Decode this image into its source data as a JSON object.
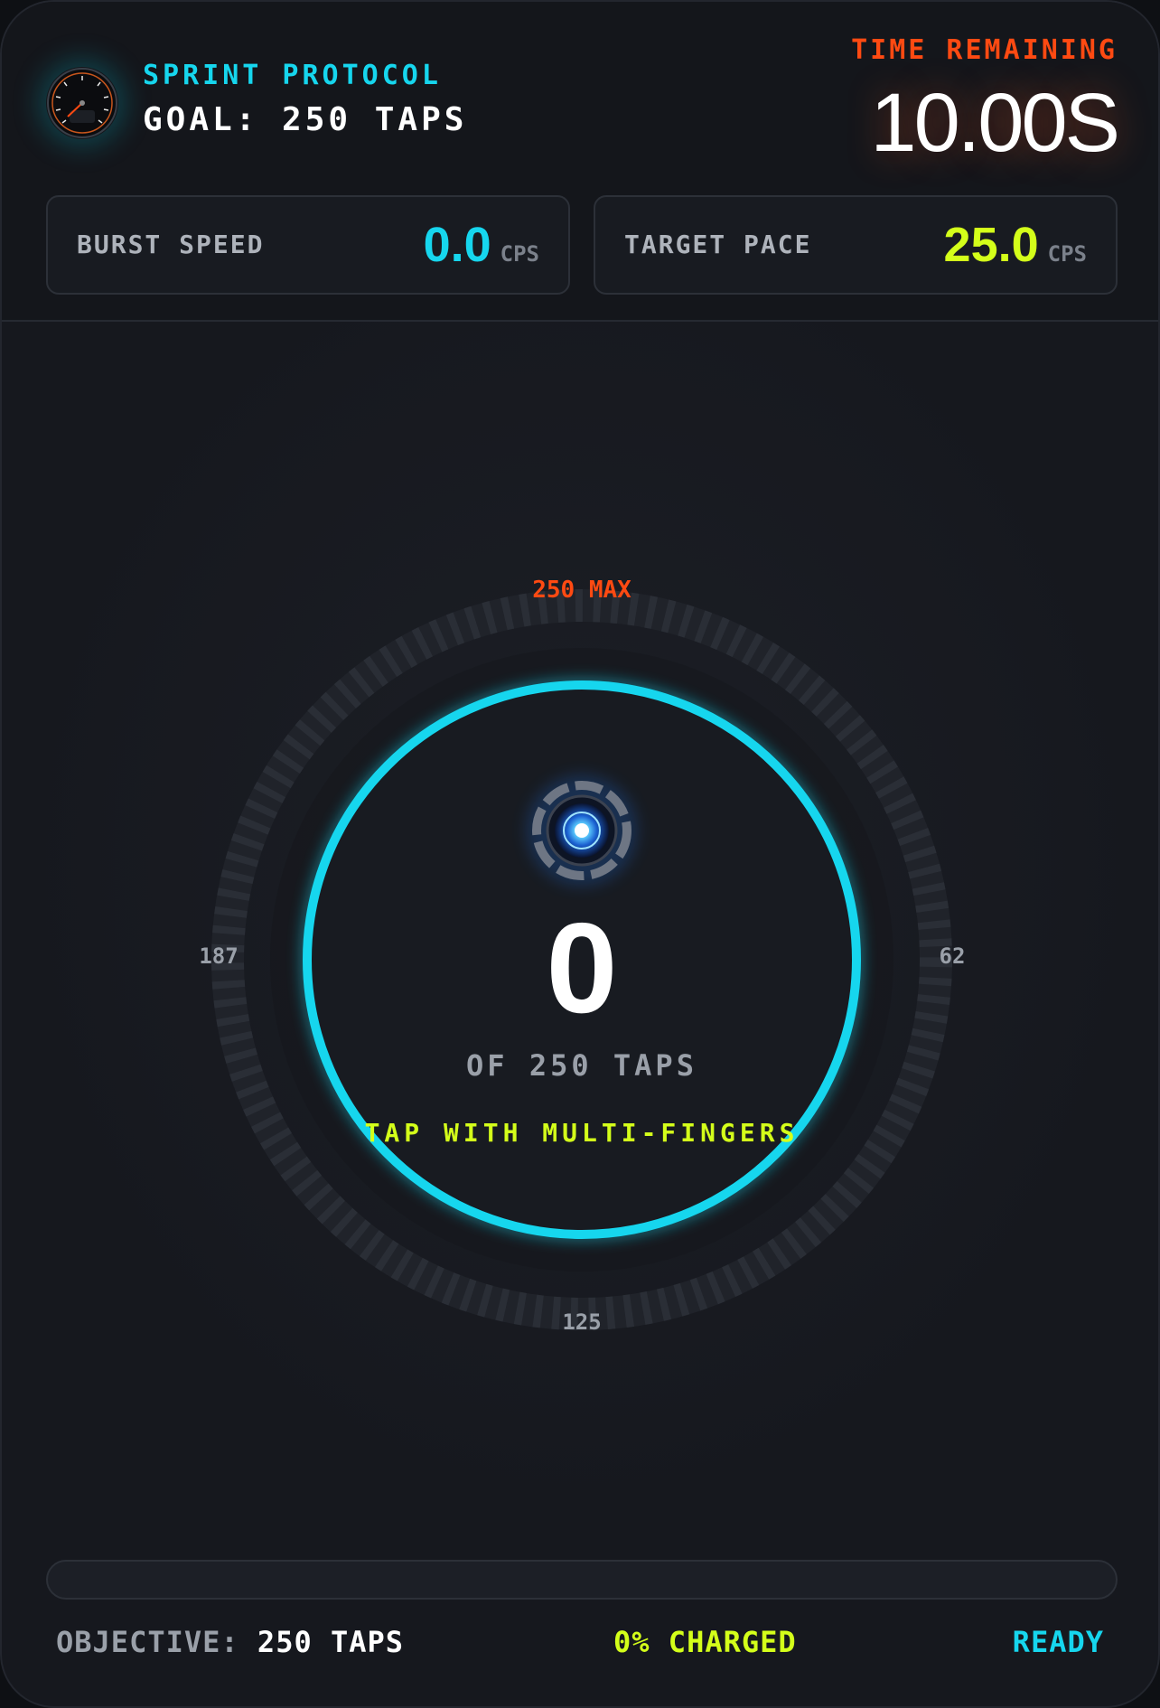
{
  "header": {
    "title": "SPRINT PROTOCOL",
    "goal": "GOAL: 250 TAPS",
    "time_label": "TIME REMAINING",
    "time_value": "10.00S"
  },
  "stats": {
    "burst": {
      "label": "BURST SPEED",
      "value": "0.0",
      "unit": "CPS"
    },
    "target": {
      "label": "TARGET PACE",
      "value": "25.0",
      "unit": "CPS"
    }
  },
  "gauge": {
    "max_label": "250 MAX",
    "tick_right": "62",
    "tick_bottom": "125",
    "tick_left": "187",
    "count": "0",
    "sub_label": "OF 250 TAPS",
    "hint": "TAP WITH MULTI-FINGERS",
    "progress_fraction": 0
  },
  "footer": {
    "objective_label": "OBJECTIVE:",
    "objective_value": "250 TAPS",
    "charged": "0% CHARGED",
    "status": "READY",
    "progress_percent": 0
  },
  "colors": {
    "cyan": "#16d6ee",
    "orange": "#ff4a12",
    "lime": "#d4ff1a",
    "white": "#ffffff",
    "muted": "#9aa0a9"
  },
  "icons": {
    "logo": "speedometer-icon",
    "core": "energy-core-icon"
  }
}
